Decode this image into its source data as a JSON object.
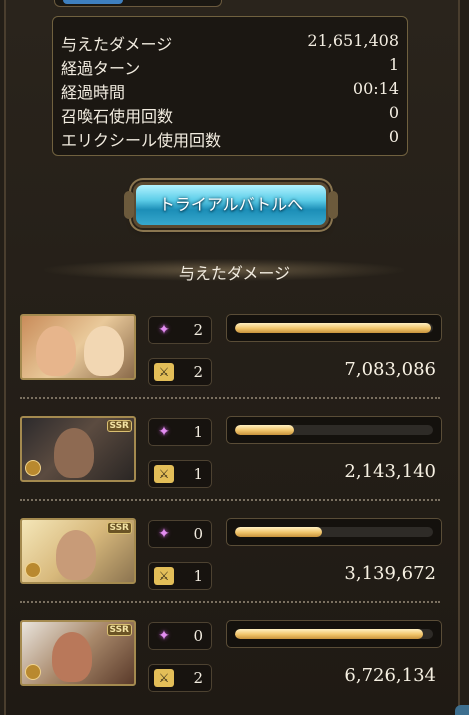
{
  "stats": [
    {
      "label": "与えたダメージ",
      "value": "21,651,408"
    },
    {
      "label": "経過ターン",
      "value": "1"
    },
    {
      "label": "経過時間",
      "value": "00:14"
    },
    {
      "label": "召喚石使用回数",
      "value": "0"
    },
    {
      "label": "エリクシール使用回数",
      "value": "0"
    }
  ],
  "trial_button": "トライアルバトルへ",
  "section_title": "与えたダメージ",
  "members": [
    {
      "ssr": "",
      "skills": "2",
      "hits": "2",
      "damage": "7,083,086",
      "damage_share": 0.99
    },
    {
      "ssr": "SSR",
      "skills": "1",
      "hits": "1",
      "damage": "2,143,140",
      "damage_share": 0.3
    },
    {
      "ssr": "SSR",
      "skills": "0",
      "hits": "1",
      "damage": "3,139,672",
      "damage_share": 0.44
    },
    {
      "ssr": "SSR",
      "skills": "0",
      "hits": "2",
      "damage": "6,726,134",
      "damage_share": 0.95
    }
  ],
  "icons": {
    "skill": "sparkle-icon",
    "hit": "crossed-swords-icon",
    "element": "element-orb-icon"
  },
  "colors": {
    "accent": "#5ccde8",
    "bar_fill": "#f0c46a",
    "frame_gold": "#a48a4f"
  }
}
